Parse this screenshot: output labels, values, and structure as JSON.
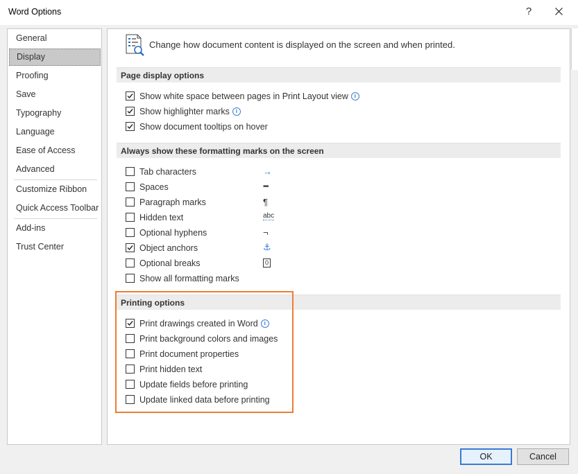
{
  "window": {
    "title": "Word Options",
    "help": "?"
  },
  "nav": {
    "items": [
      "General",
      "Display",
      "Proofing",
      "Save",
      "Typography",
      "Language",
      "Ease of Access",
      "Advanced",
      "Customize Ribbon",
      "Quick Access Toolbar",
      "Add-ins",
      "Trust Center"
    ],
    "selected": "Display"
  },
  "header": {
    "text": "Change how document content is displayed on the screen and when printed.",
    "icon": "display-options-icon"
  },
  "sections": {
    "page_display": {
      "title": "Page display options",
      "options": [
        {
          "label": "Show white space between pages in Print Layout view",
          "checked": true,
          "info": true
        },
        {
          "label": "Show highlighter marks",
          "checked": true,
          "info": true
        },
        {
          "label": "Show document tooltips on hover",
          "checked": true,
          "info": false
        }
      ]
    },
    "formatting_marks": {
      "title": "Always show these formatting marks on the screen",
      "options": [
        {
          "label": "Tab characters",
          "checked": false,
          "symbol": "→",
          "symbol_icon": "tab-arrow-icon"
        },
        {
          "label": "Spaces",
          "checked": false,
          "symbol": "•••",
          "symbol_icon": "space-dots-icon"
        },
        {
          "label": "Paragraph marks",
          "checked": false,
          "symbol": "¶",
          "symbol_icon": "pilcrow-icon"
        },
        {
          "label": "Hidden text",
          "checked": false,
          "symbol": "abc",
          "symbol_icon": "hidden-text-icon"
        },
        {
          "label": "Optional hyphens",
          "checked": false,
          "symbol": "¬",
          "symbol_icon": "optional-hyphen-icon"
        },
        {
          "label": "Object anchors",
          "checked": true,
          "symbol": "⚓",
          "symbol_icon": "anchor-icon"
        },
        {
          "label": "Optional breaks",
          "checked": false,
          "symbol": "0",
          "symbol_icon": "optional-break-icon"
        },
        {
          "label": "Show all formatting marks",
          "checked": false
        }
      ]
    },
    "printing": {
      "title": "Printing options",
      "options": [
        {
          "label": "Print drawings created in Word",
          "checked": true,
          "info": true
        },
        {
          "label": "Print background colors and images",
          "checked": false
        },
        {
          "label": "Print document properties",
          "checked": false
        },
        {
          "label": "Print hidden text",
          "checked": false
        },
        {
          "label": "Update fields before printing",
          "checked": false
        },
        {
          "label": "Update linked data before printing",
          "checked": false
        }
      ]
    }
  },
  "buttons": {
    "ok": "OK",
    "cancel": "Cancel"
  },
  "colors": {
    "highlight_border": "#ed7d31",
    "accent": "#3a79d6",
    "selected_nav": "#c9c9c9"
  }
}
